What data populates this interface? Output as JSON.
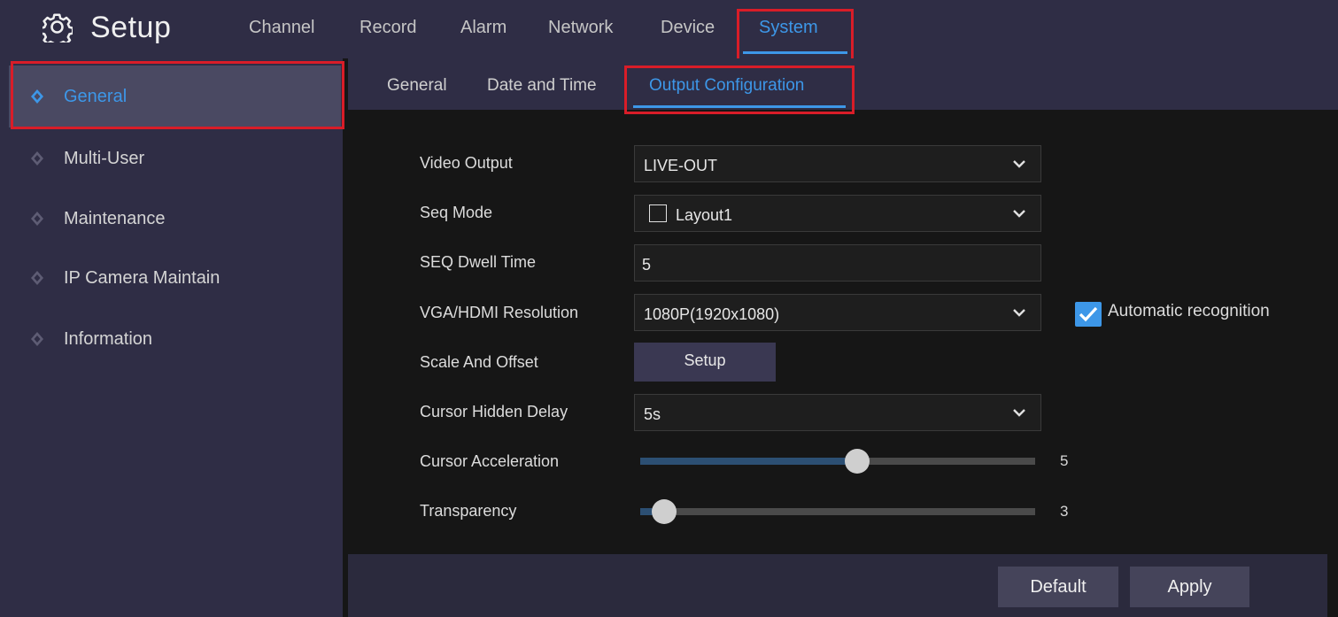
{
  "app": {
    "title": "Setup",
    "icon": "gear-icon"
  },
  "top_nav": {
    "items": [
      {
        "label": "Channel"
      },
      {
        "label": "Record"
      },
      {
        "label": "Alarm"
      },
      {
        "label": "Network"
      },
      {
        "label": "Device"
      },
      {
        "label": "System",
        "active": true
      }
    ]
  },
  "sidebar": {
    "items": [
      {
        "label": "General",
        "active": true
      },
      {
        "label": "Multi-User"
      },
      {
        "label": "Maintenance"
      },
      {
        "label": "IP Camera Maintain"
      },
      {
        "label": "Information"
      }
    ]
  },
  "sub_tabs": [
    {
      "label": "General"
    },
    {
      "label": "Date and Time"
    },
    {
      "label": "Output Configuration",
      "active": true
    }
  ],
  "form": {
    "video_output": {
      "label": "Video Output",
      "value": "LIVE-OUT"
    },
    "seq_mode": {
      "label": "Seq Mode",
      "value": "Layout1",
      "checked": false
    },
    "seq_dwell_time": {
      "label": "SEQ Dwell Time",
      "value": "5"
    },
    "resolution": {
      "label": "VGA/HDMI Resolution",
      "value": "1080P(1920x1080)"
    },
    "auto_recognition": {
      "label": "Automatic recognition",
      "checked": true
    },
    "scale_offset": {
      "label": "Scale And Offset",
      "button": "Setup"
    },
    "cursor_hidden_delay": {
      "label": "Cursor Hidden Delay",
      "value": "5s"
    },
    "cursor_acceleration": {
      "label": "Cursor Acceleration",
      "value": "5",
      "fill_fraction": 0.55
    },
    "transparency": {
      "label": "Transparency",
      "value": "3",
      "fill_fraction": 0.06
    }
  },
  "footer": {
    "default_label": "Default",
    "apply_label": "Apply"
  },
  "colors": {
    "accent": "#3d97e8",
    "highlight_box": "#d91d28",
    "panel": "#2f2d45",
    "background": "#161616"
  }
}
